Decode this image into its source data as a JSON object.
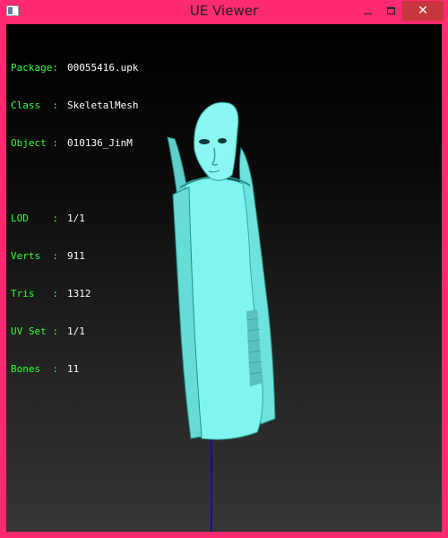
{
  "window": {
    "title": "UE Viewer",
    "close_glyph": "✕"
  },
  "info": {
    "rows_top": [
      {
        "label": "Package:",
        "value": "00055416.upk"
      },
      {
        "label": "Class  :",
        "value": "SkeletalMesh"
      },
      {
        "label": "Object :",
        "value": "010136_JinM"
      }
    ],
    "rows_bottom": [
      {
        "label": "LOD    :",
        "value": "1/1"
      },
      {
        "label": "Verts  :",
        "value": "911"
      },
      {
        "label": "Tris   :",
        "value": "1312"
      },
      {
        "label": "UV Set :",
        "value": "1/1"
      },
      {
        "label": "Bones  :",
        "value": "11"
      }
    ]
  },
  "colors": {
    "frame": "#ff2a6f",
    "label": "#33ff33",
    "value": "#ffffff",
    "mesh": "#7ef5ef",
    "axis": "#1010a0"
  }
}
